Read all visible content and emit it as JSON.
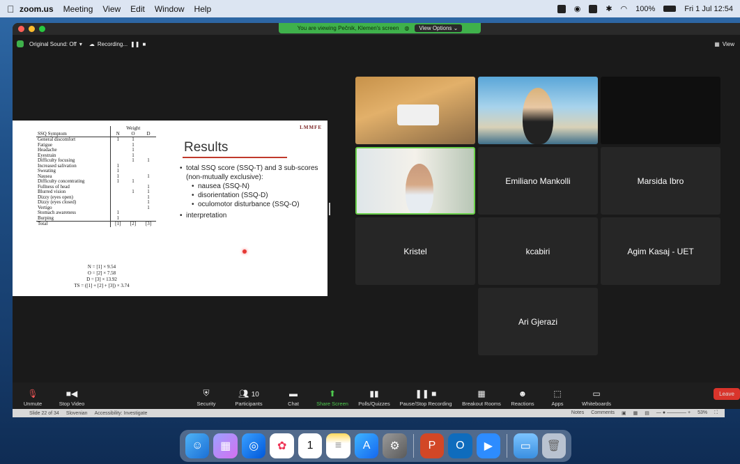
{
  "menubar": {
    "apple": "",
    "items": [
      "zoom.us",
      "Meeting",
      "View",
      "Edit",
      "Window",
      "Help"
    ],
    "battery": "100%",
    "clock": "Fri 1 Jul 12:54"
  },
  "zoom": {
    "banner_text": "You are viewing Pečnik, Klemen's screen",
    "view_options": "View Options ⌄",
    "original_sound": "Original Sound: Off",
    "recording": "Recording...",
    "view": "View"
  },
  "slide": {
    "logo": "LMMFE",
    "title": "Results",
    "table_header_weight": "Weight",
    "table_cols": [
      "SSQ Symptom",
      "N",
      "O",
      "D"
    ],
    "table_rows": [
      [
        "General discomfort",
        "1",
        "1",
        ""
      ],
      [
        "Fatigue",
        "",
        "1",
        ""
      ],
      [
        "Headache",
        "",
        "1",
        ""
      ],
      [
        "Eyestrain",
        "",
        "1",
        ""
      ],
      [
        "Difficulty focusing",
        "",
        "1",
        "1"
      ],
      [
        "Increased salivation",
        "1",
        "",
        ""
      ],
      [
        "Sweating",
        "1",
        "",
        ""
      ],
      [
        "Nausea",
        "1",
        "",
        "1"
      ],
      [
        "Difficulty concentrating",
        "1",
        "1",
        ""
      ],
      [
        "Fullness of head",
        "",
        "",
        "1"
      ],
      [
        "Blurred vision",
        "",
        "1",
        "1"
      ],
      [
        "Dizzy (eyes open)",
        "",
        "",
        "1"
      ],
      [
        "Dizzy (eyes closed)",
        "",
        "",
        "1"
      ],
      [
        "Vertigo",
        "",
        "",
        "1"
      ],
      [
        "Stomach awareness",
        "1",
        "",
        ""
      ],
      [
        "Burping",
        "1",
        "",
        ""
      ]
    ],
    "table_total": [
      "Total",
      "[1]",
      "[2]",
      "[3]"
    ],
    "formulas": [
      "N = [1] × 9.54",
      "O = [2] × 7.58",
      "D = [3] × 13.92",
      "TS = ([1] + [2] + [3]) × 3.74"
    ],
    "bullets": {
      "b1": "total SSQ score (SSQ-T) and 3 sub-scores (non-mutually exclusive):",
      "s1": "nausea (SSQ-N)",
      "s2": "disorientation (SSQ-D)",
      "s3": "oculomotor disturbance (SSQ-O)",
      "b2": "interpretation"
    }
  },
  "participants": {
    "emiliano": "Emiliano Mankolli",
    "marsida": "Marsida Ibro",
    "kristel": "Kristel",
    "kcabiri": "kcabiri",
    "agim": "Agim Kasaj - UET",
    "ari": "Ari Gjerazi"
  },
  "toolbar": {
    "unmute": "Unmute",
    "stop_video": "Stop Video",
    "security": "Security",
    "participants": "Participants",
    "participants_count": "10",
    "chat": "Chat",
    "share_screen": "Share Screen",
    "polls": "Polls/Quizzes",
    "pause_recording": "Pause/Stop Recording",
    "breakout": "Breakout Rooms",
    "reactions": "Reactions",
    "apps": "Apps",
    "whiteboards": "Whiteboards",
    "leave": "Leave"
  },
  "ppt_status": {
    "slide": "Slide 22 of 34",
    "language": "Slovenian",
    "accessibility": "Accessibility: Investigate",
    "notes": "Notes",
    "comments": "Comments",
    "zoom": "53%"
  },
  "colors": {
    "zoom_green": "#3fb14b",
    "leave_red": "#d9342b",
    "slide_accent": "#c0392b"
  }
}
